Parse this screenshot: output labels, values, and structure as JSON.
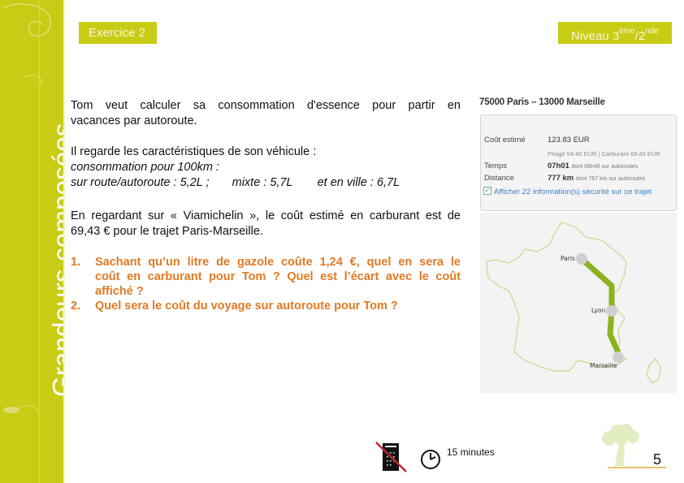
{
  "sidebar": {
    "title": "Grandeurs composées"
  },
  "header": {
    "exercise_label": "Exercice 2",
    "level_prefix": "Niveau 3",
    "level_sup1": "ème",
    "level_sep": "/2",
    "level_sup2": "nde"
  },
  "body": {
    "p1_line1": "Tom veut calculer sa consommation d'essence pour partir en",
    "p1_line2": "vacances par autoroute.",
    "p2_line1": "Il regarde les caractéristiques de son véhicule :",
    "p2_line2": "consommation pour 100km :",
    "p2_route": "sur route/autoroute : 5,2L ;",
    "p2_mixte": "mixte : 5,7L",
    "p2_ville": "et en ville : 6,7L",
    "p3_line1": "En regardant sur « Viamichelin », le coût estimé en carburant est de",
    "p3_line2": "69,43 €  pour le trajet Paris-Marseille."
  },
  "questions": [
    {
      "num": "1.",
      "line1": "Sachant qu’un litre de gazole coûte 1,24 €, quel en sera le",
      "line2": "coût en carburant  pour Tom ? Quel est l’écart avec le coût",
      "line3": "affiché ?"
    },
    {
      "num": "2.",
      "line1": "Quel sera le coût du voyage sur autoroute pour Tom ?"
    }
  ],
  "viamichelin": {
    "route_title": "75000 Paris – 13000 Marseille",
    "cost_label": "Coût estimé",
    "cost_value": "123.83 EUR",
    "cost_detail": "Péage 54.40 EUR | Carburant 69.43 EUR",
    "time_label": "Temps",
    "time_value": "07h01",
    "time_detail": "dont 06h46 sur autoroutes",
    "distance_label": "Distance",
    "distance_value": "777 km",
    "distance_detail": "dont 767 km sur autoroutes",
    "safety_link": "Afficher 22 information(s) sécurité sur ce trajet",
    "map_cities": [
      "Paris",
      "Lyon",
      "Marseille"
    ]
  },
  "footer": {
    "duration": "15 minutes",
    "page_number": "5",
    "icons": [
      "no-calculator-icon",
      "clock-icon",
      "tree-logo"
    ]
  },
  "colors": {
    "accent": "#c8cc14",
    "question": "#e07a24",
    "route": "#8cb21e",
    "link": "#3b7fc4"
  }
}
